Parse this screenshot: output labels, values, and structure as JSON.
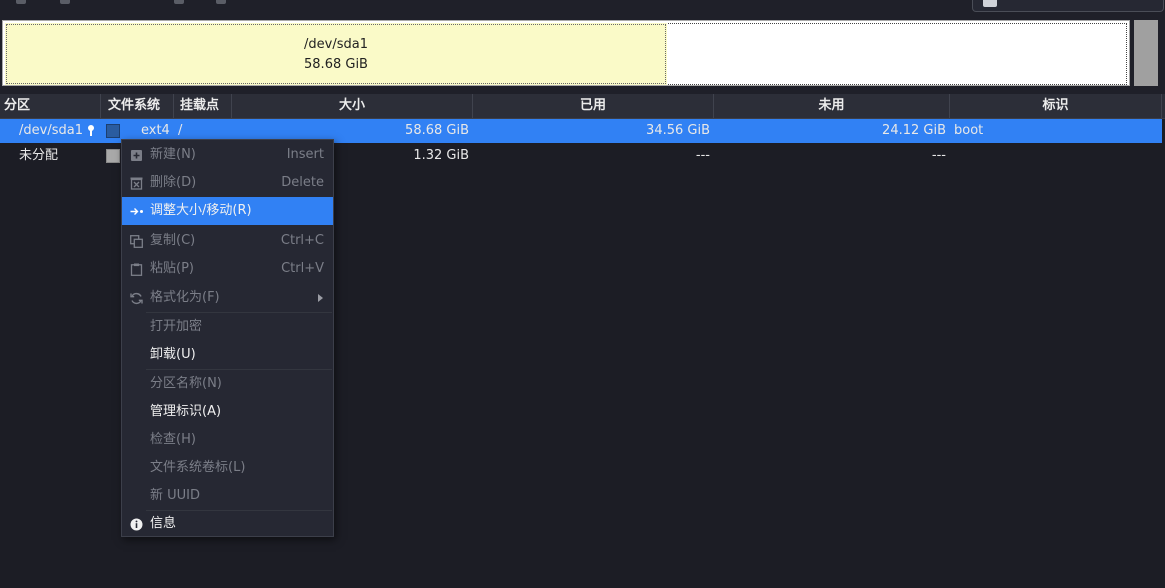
{
  "disk": {
    "partition_name": "/dev/sda1",
    "partition_size": "58.68 GiB",
    "partition_color": "#fafac8",
    "unallocated_color": "#ffffff"
  },
  "table": {
    "columns": [
      "分区",
      "文件系统",
      "挂载点",
      "大小",
      "已用",
      "未用",
      "标识"
    ],
    "rows": [
      {
        "partition": "/dev/sda1",
        "has_key_icon": true,
        "fs_color": "#2a5ca0",
        "filesystem": "ext4",
        "mountpoint": "/",
        "size": "58.68 GiB",
        "used": "34.56 GiB",
        "unused": "24.12 GiB",
        "flags": "boot",
        "selected": true
      },
      {
        "partition": "未分配",
        "has_key_icon": false,
        "fs_color": "#a9a9a9",
        "filesystem": "",
        "mountpoint": "",
        "size": "1.32 GiB",
        "used": "---",
        "unused": "---",
        "flags": "",
        "selected": false
      }
    ]
  },
  "context_menu": {
    "items": [
      {
        "label": "新建(N)",
        "shortcut": "Insert",
        "icon": "new-icon",
        "enabled": false
      },
      {
        "label": "删除(D)",
        "shortcut": "Delete",
        "icon": "delete-icon",
        "enabled": false
      },
      {
        "label": "调整大小/移动(R)",
        "shortcut": "",
        "icon": "resize-move-icon",
        "enabled": true,
        "active": true
      },
      {
        "label": "复制(C)",
        "shortcut": "Ctrl+C",
        "icon": "copy-icon",
        "enabled": false
      },
      {
        "label": "粘贴(P)",
        "shortcut": "Ctrl+V",
        "icon": "paste-icon",
        "enabled": false
      },
      {
        "label": "格式化为(F)",
        "shortcut": "",
        "icon": "format-icon",
        "enabled": false,
        "submenu": true
      },
      {
        "label": "打开加密",
        "shortcut": "",
        "icon": "",
        "enabled": false
      },
      {
        "label": "卸载(U)",
        "shortcut": "",
        "icon": "",
        "enabled": true
      },
      {
        "label": "分区名称(N)",
        "shortcut": "",
        "icon": "",
        "enabled": false
      },
      {
        "label": "管理标识(A)",
        "shortcut": "",
        "icon": "",
        "enabled": true
      },
      {
        "label": "检查(H)",
        "shortcut": "",
        "icon": "",
        "enabled": false
      },
      {
        "label": "文件系统卷标(L)",
        "shortcut": "",
        "icon": "",
        "enabled": false
      },
      {
        "label": "新 UUID",
        "shortcut": "",
        "icon": "",
        "enabled": false
      },
      {
        "label": "信息",
        "shortcut": "",
        "icon": "info-icon",
        "enabled": true
      }
    ]
  },
  "colors": {
    "accent": "#3181f4",
    "background": "#1c1d25",
    "menu_background": "#262833"
  }
}
